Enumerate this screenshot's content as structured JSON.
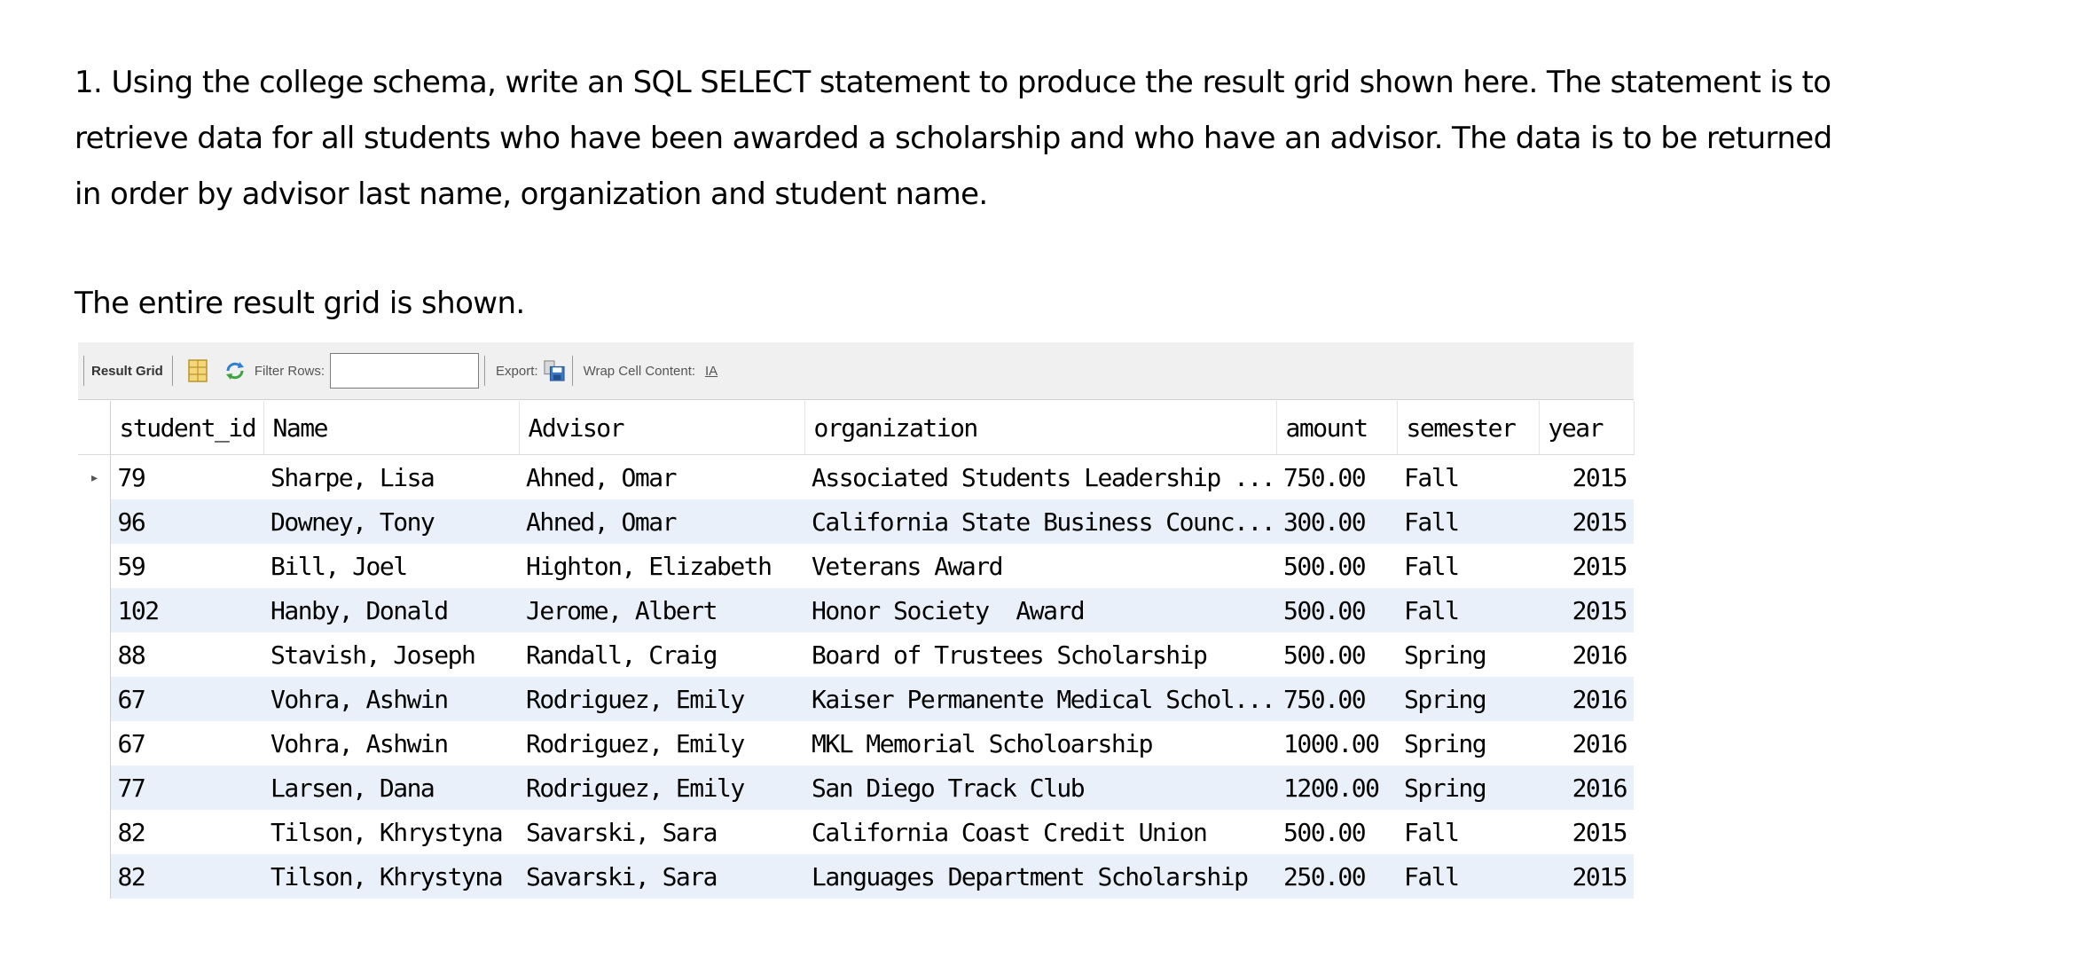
{
  "question": {
    "lines": [
      "1. Using the college schema, write an SQL SELECT statement to produce the result grid shown here. The statement is to",
      "retrieve data for all students who have been awarded a scholarship and who have an advisor. The data is to be returned",
      "in order by advisor last name, organization and student name."
    ]
  },
  "caption": "The entire result grid is shown.",
  "toolbar": {
    "result_grid_label": "Result Grid",
    "filter_rows_label": "Filter Rows:",
    "filter_value": "",
    "export_label": "Export:",
    "wrap_label": "Wrap Cell Content:",
    "wrap_icon_glyph": "IA"
  },
  "icons": {
    "grid": "grid-icon",
    "refresh": "refresh-icon",
    "export": "save-icon",
    "wrap": "wrap-text-icon",
    "row_pointer": "row-pointer-icon"
  },
  "grid": {
    "columns": [
      "student_id",
      "Name",
      "Advisor",
      "organization",
      "amount",
      "semester",
      "year"
    ],
    "rows": [
      [
        "79",
        "Sharpe, Lisa",
        "Ahned, Omar",
        "Associated Students Leadership ...",
        "750.00",
        "Fall",
        "2015"
      ],
      [
        "96",
        "Downey, Tony",
        "Ahned, Omar",
        "California State Business Counc...",
        "300.00",
        "Fall",
        "2015"
      ],
      [
        "59",
        "Bill, Joel",
        "Highton, Elizabeth",
        "Veterans Award",
        "500.00",
        "Fall",
        "2015"
      ],
      [
        "102",
        "Hanby, Donald",
        "Jerome, Albert",
        "Honor Society  Award",
        "500.00",
        "Fall",
        "2015"
      ],
      [
        "88",
        "Stavish, Joseph",
        "Randall, Craig",
        "Board of Trustees Scholarship",
        "500.00",
        "Spring",
        "2016"
      ],
      [
        "67",
        "Vohra, Ashwin",
        "Rodriguez, Emily",
        "Kaiser Permanente Medical Schol...",
        "750.00",
        "Spring",
        "2016"
      ],
      [
        "67",
        "Vohra, Ashwin",
        "Rodriguez, Emily",
        "MKL Memorial Scholoarship",
        "1000.00",
        "Spring",
        "2016"
      ],
      [
        "77",
        "Larsen, Dana",
        "Rodriguez, Emily",
        "San Diego Track Club",
        "1200.00",
        "Spring",
        "2016"
      ],
      [
        "82",
        "Tilson, Khrystyna",
        "Savarski, Sara",
        "California Coast Credit Union",
        "500.00",
        "Fall",
        "2015"
      ],
      [
        "82",
        "Tilson, Khrystyna",
        "Savarski, Sara",
        "Languages Department Scholarship",
        "250.00",
        "Fall",
        "2015"
      ]
    ],
    "selected_row_marker": "▸"
  },
  "colors": {
    "alt_row": "#eaf0fa",
    "toolbar_bg": "#f0f0f0"
  }
}
